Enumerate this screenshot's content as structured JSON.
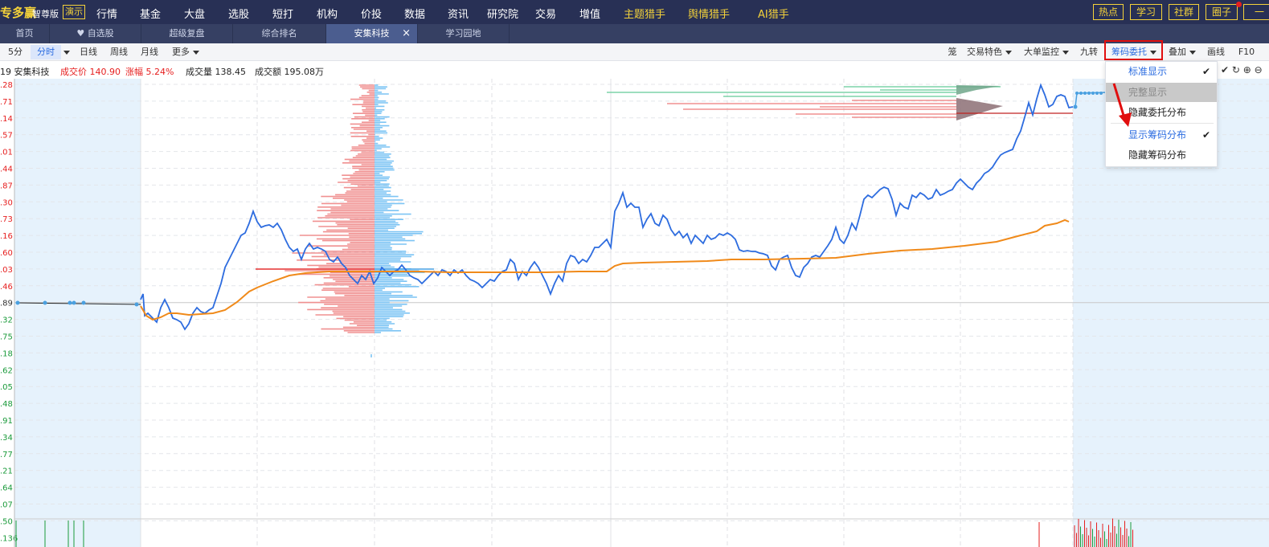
{
  "header": {
    "brand": "专多赢",
    "edition": "智尊版",
    "demo": "演示",
    "nav": [
      "行情",
      "基金",
      "大盘",
      "选股",
      "短打",
      "机构",
      "价投",
      "数据",
      "资讯",
      "研究院",
      "交易",
      "增值"
    ],
    "hunters": [
      "主题猎手",
      "舆情猎手",
      "AI猎手"
    ],
    "right_buttons": [
      "热点",
      "学习",
      "社群",
      "圈子",
      "一"
    ]
  },
  "tabs": [
    "首页",
    "自选股",
    "超级复盘",
    "综合排名",
    "安集科技",
    "学习园地"
  ],
  "tab_close": "×",
  "toolbar": {
    "left": [
      "5分",
      "分时",
      "日线",
      "周线",
      "月线",
      "更多"
    ],
    "right": [
      "笼",
      "交易特色",
      "大单监控",
      "九转",
      "筹码委托",
      "叠加",
      "画线",
      "F10"
    ]
  },
  "info": {
    "name": "19 安集科技",
    "price": "成交价 140.90",
    "change": "涨幅 5.24%",
    "volume": "成交量 138.45",
    "amount": "成交额 195.08万"
  },
  "dropdown": {
    "items": [
      "标准显示",
      "完整显示",
      "隐藏委托分布",
      "显示筹码分布",
      "隐藏筹码分布"
    ],
    "check": "✔"
  },
  "toolbar_icons": "✔ ↻ ⊕ ⊖",
  "axis_labels": [
    ".28",
    ".71",
    ".14",
    ".57",
    ".01",
    ".44",
    ".87",
    ".30",
    ".73",
    ".16",
    ".60",
    ".03",
    ".46",
    ".89",
    ".32",
    ".75",
    ".18",
    ".62",
    ".05",
    ".48",
    ".91",
    ".34",
    ".77",
    ".21",
    ".64",
    ".07",
    ".50",
    ".136"
  ],
  "colors": {
    "nav_bg": "#283055",
    "tab_bg": "#364063",
    "price_line": "#2d6cdf",
    "avg_line": "#f08a1a",
    "up": "#e61e1e",
    "down": "#1a9a3a",
    "chip_sell": "#f09090",
    "chip_buy": "#7cc4f4"
  }
}
